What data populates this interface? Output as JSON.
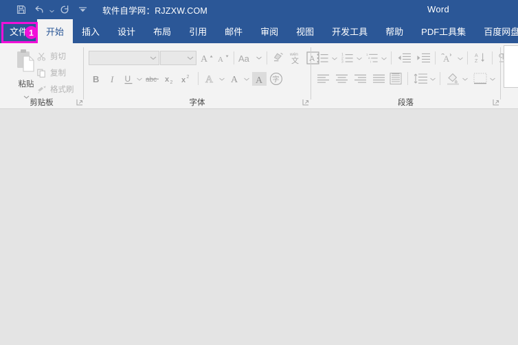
{
  "titlebar": {
    "document_title": "软件自学网：RJZXW.COM",
    "app_name": "Word",
    "quick_access": [
      {
        "name": "save",
        "icon": "save-icon"
      },
      {
        "name": "undo",
        "icon": "undo-icon"
      },
      {
        "name": "redo",
        "icon": "redo-icon"
      },
      {
        "name": "customize",
        "icon": "chevron-down-icon"
      }
    ]
  },
  "tabs": [
    {
      "label": "文件",
      "active": false,
      "highlighted": true
    },
    {
      "label": "开始",
      "active": true
    },
    {
      "label": "插入",
      "active": false
    },
    {
      "label": "设计",
      "active": false
    },
    {
      "label": "布局",
      "active": false
    },
    {
      "label": "引用",
      "active": false
    },
    {
      "label": "邮件",
      "active": false
    },
    {
      "label": "审阅",
      "active": false
    },
    {
      "label": "视图",
      "active": false
    },
    {
      "label": "开发工具",
      "active": false
    },
    {
      "label": "帮助",
      "active": false
    },
    {
      "label": "PDF工具集",
      "active": false
    },
    {
      "label": "百度网盘",
      "active": false
    }
  ],
  "annotation": {
    "badge_number": "1",
    "color": "#f210d8",
    "target": "文件"
  },
  "ribbon": {
    "groups": [
      {
        "id": "clipboard",
        "label": "剪贴板",
        "paste": {
          "label": "粘贴",
          "icon": "paste-icon"
        },
        "items": [
          {
            "label": "剪切",
            "icon": "scissors-icon"
          },
          {
            "label": "复制",
            "icon": "copy-icon"
          },
          {
            "label": "格式刷",
            "icon": "format-painter-icon"
          }
        ]
      },
      {
        "id": "font",
        "label": "字体",
        "font_name": {
          "value": "",
          "placeholder": ""
        },
        "font_size": {
          "value": "",
          "placeholder": ""
        },
        "row1": [
          {
            "name": "grow-font-icon",
            "glyph": "A"
          },
          {
            "name": "shrink-font-icon",
            "glyph": "A"
          },
          {
            "name": "change-case-icon",
            "glyph": "Aa"
          },
          {
            "name": "clear-formatting-icon",
            "glyph": ""
          },
          {
            "name": "phonetic-guide-icon",
            "glyph": "文"
          },
          {
            "name": "character-border-icon",
            "glyph": "A"
          }
        ],
        "row2": [
          {
            "name": "bold-icon",
            "glyph": "B"
          },
          {
            "name": "italic-icon",
            "glyph": "I"
          },
          {
            "name": "underline-icon",
            "glyph": "U"
          },
          {
            "name": "strikethrough-icon",
            "glyph": "abc"
          },
          {
            "name": "subscript-icon",
            "glyph": "x₂"
          },
          {
            "name": "superscript-icon",
            "glyph": "x²"
          },
          {
            "name": "text-effects-icon",
            "glyph": "A"
          },
          {
            "name": "text-highlight-color-icon",
            "glyph": "A"
          },
          {
            "name": "font-color-icon",
            "glyph": "A"
          },
          {
            "name": "enclose-characters-icon",
            "glyph": "字"
          }
        ]
      },
      {
        "id": "paragraph",
        "label": "段落",
        "row1": [
          {
            "name": "bullets-icon"
          },
          {
            "name": "numbering-icon"
          },
          {
            "name": "multilevel-list-icon"
          },
          {
            "name": "decrease-indent-icon"
          },
          {
            "name": "increase-indent-icon"
          },
          {
            "name": "asian-layout-icon"
          },
          {
            "name": "sort-icon"
          },
          {
            "name": "show-formatting-marks-icon"
          }
        ],
        "row2": [
          {
            "name": "align-left-icon"
          },
          {
            "name": "align-center-icon"
          },
          {
            "name": "align-right-icon"
          },
          {
            "name": "justify-icon"
          },
          {
            "name": "distribute-icon"
          },
          {
            "name": "line-spacing-icon"
          },
          {
            "name": "shading-icon"
          },
          {
            "name": "borders-icon"
          }
        ]
      },
      {
        "id": "styles",
        "label": ""
      }
    ]
  },
  "document": {
    "background": "#e4e4e4",
    "content": ""
  },
  "theme": {
    "titlebar_blue": "#2b5797",
    "ribbon_gray": "#f3f3f3",
    "body_gray": "#e4e4e4",
    "accent_magenta": "#f210d8"
  }
}
